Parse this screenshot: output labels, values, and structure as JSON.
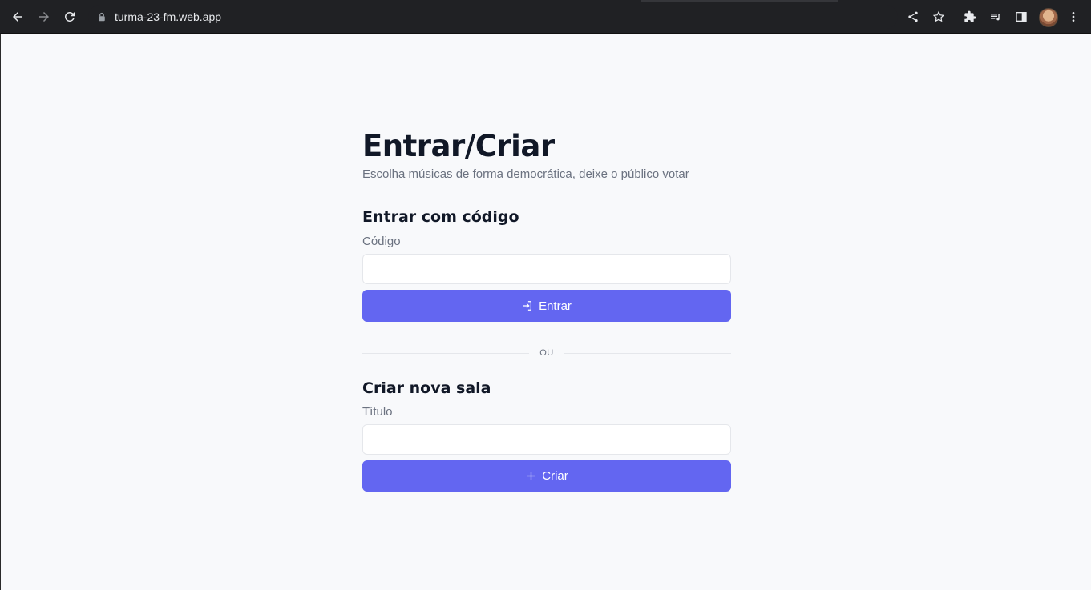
{
  "browser": {
    "url": "turma-23-fm.web.app"
  },
  "page": {
    "title": "Entrar/Criar",
    "subtitle": "Escolha músicas de forma democrática, deixe o público votar",
    "join_section": {
      "heading": "Entrar com código",
      "field_label": "Código",
      "field_value": "",
      "button_label": "Entrar",
      "button_icon": "login-icon"
    },
    "divider_text": "OU",
    "create_section": {
      "heading": "Criar nova sala",
      "field_label": "Título",
      "field_value": "",
      "button_label": "Criar",
      "button_icon": "plus-icon"
    }
  },
  "colors": {
    "accent": "#6366f1",
    "background": "#f8f9fb",
    "text_primary": "#111827",
    "text_secondary": "#6b7280",
    "browser_chrome": "#202124"
  }
}
